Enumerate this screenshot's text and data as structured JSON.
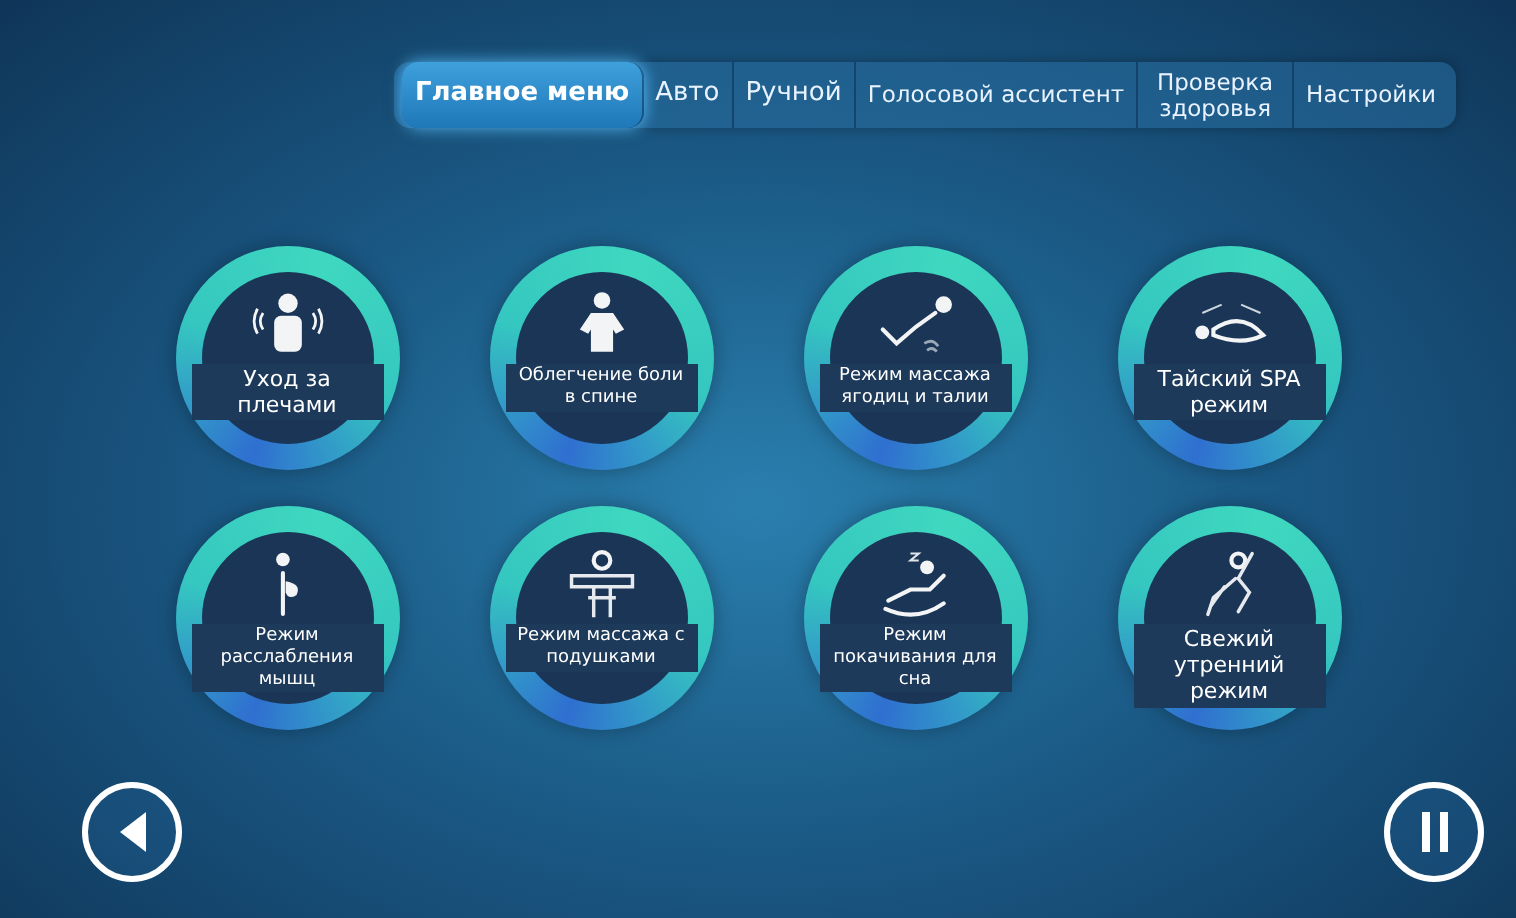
{
  "tabs": [
    {
      "label": "Главное меню",
      "selected": true
    },
    {
      "label": "Авто",
      "selected": false
    },
    {
      "label": "Ручной",
      "selected": false
    },
    {
      "label": "Голосовой ассистент",
      "selected": false
    },
    {
      "label": "Проверка здоровья",
      "selected": false
    },
    {
      "label": "Настройки",
      "selected": false
    }
  ],
  "modes": [
    {
      "label": "Уход за плечами",
      "kind": "shoulders"
    },
    {
      "label": "Облегчение боли в спине",
      "kind": "back"
    },
    {
      "label": "Режим массажа ягодиц и талии",
      "kind": "hips"
    },
    {
      "label": "Тайский SPA режим",
      "kind": "thai"
    },
    {
      "label": "Режим расслабления мышц",
      "kind": "relax"
    },
    {
      "label": "Режим массажа с подушками",
      "kind": "pillow"
    },
    {
      "label": "Режим покачивания для сна",
      "kind": "rocking"
    },
    {
      "label": "Свежий утренний режим",
      "kind": "morning"
    }
  ]
}
